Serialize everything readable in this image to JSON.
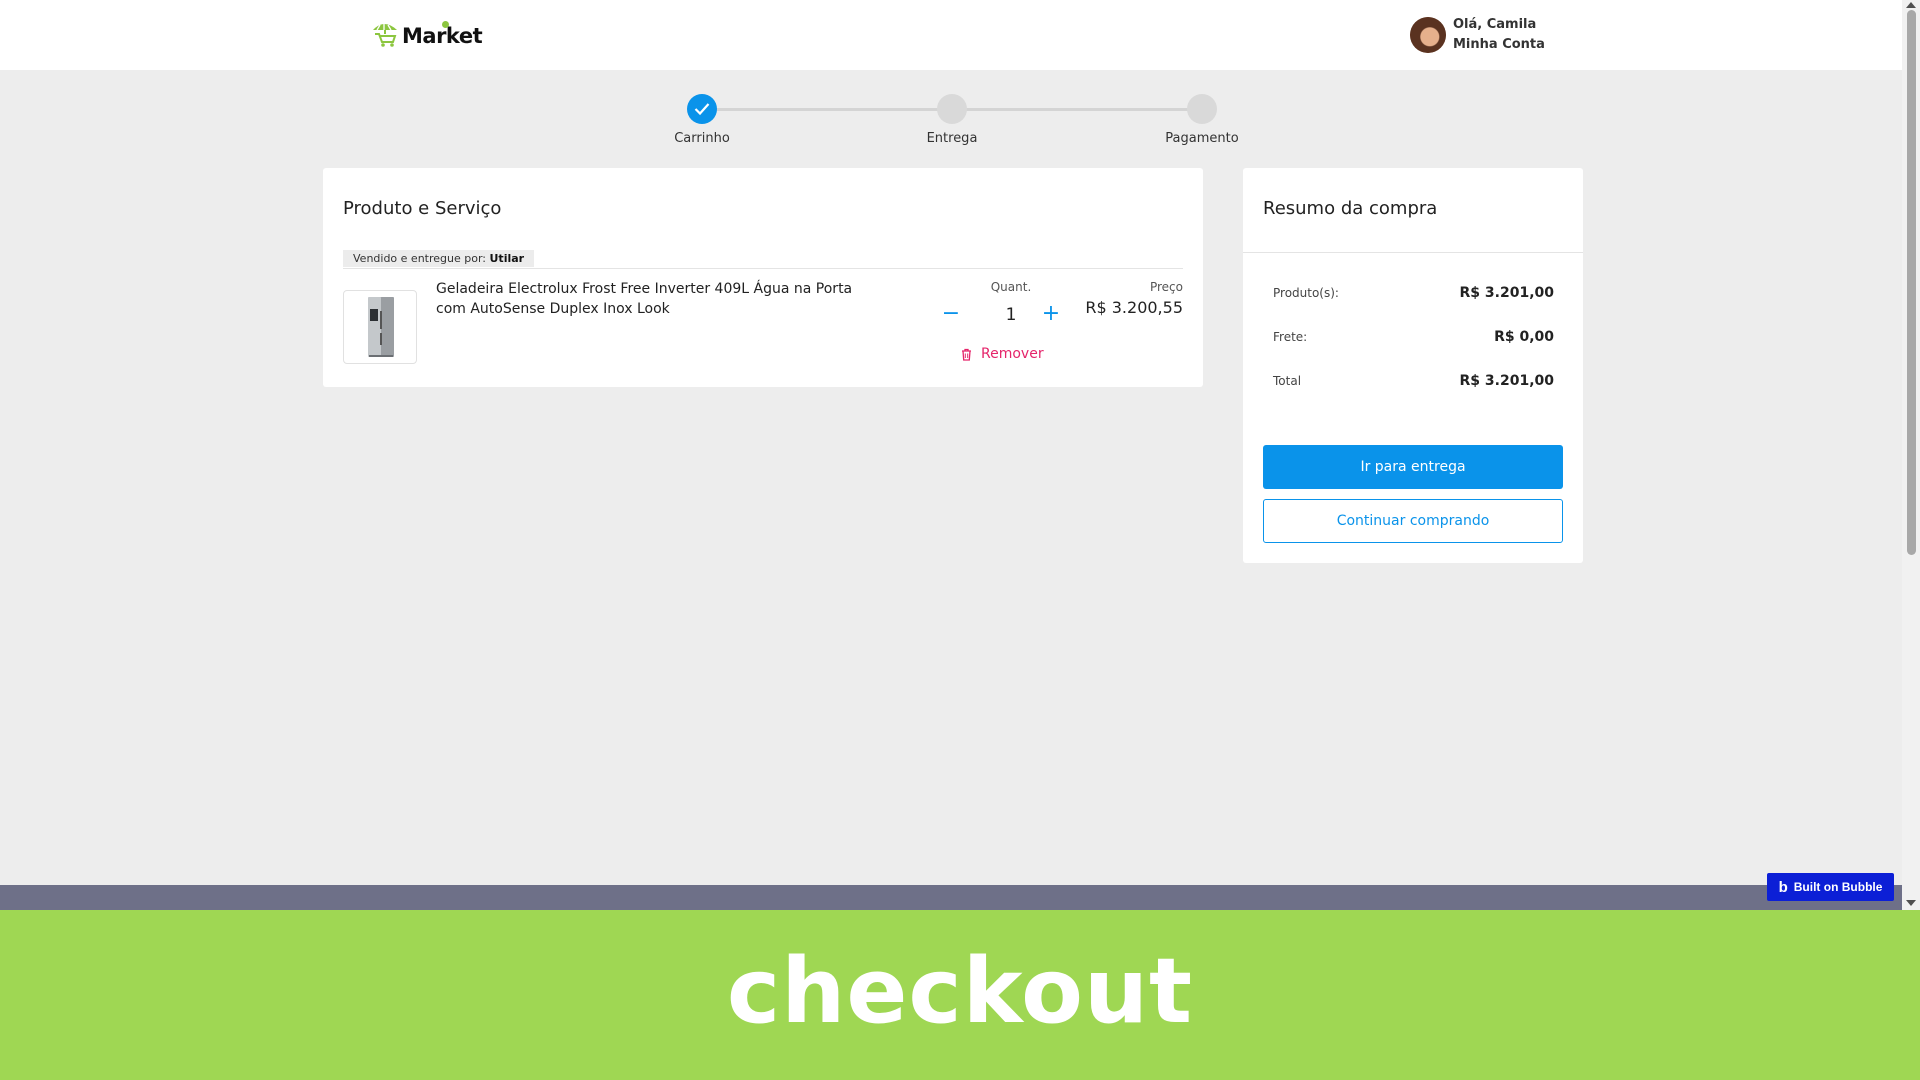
{
  "header": {
    "logo_text": "Market",
    "greeting": "Olá, Camila",
    "account_link": "Minha Conta"
  },
  "stepper": {
    "steps": [
      {
        "label": "Carrinho",
        "status": "done"
      },
      {
        "label": "Entrega",
        "status": "pending"
      },
      {
        "label": "Pagamento",
        "status": "pending"
      }
    ]
  },
  "cart": {
    "title": "Produto e Serviço",
    "seller_prefix": "Vendido e entregue por:",
    "seller_name": "Utilar",
    "item": {
      "name": "Geladeira Electrolux Frost Free Inverter 409L Água na Porta com AutoSense Duplex Inox Look",
      "qty_label": "Quant.",
      "quantity": "1",
      "minus_symbol": "−",
      "plus_symbol": "+",
      "remove_label": "Remover",
      "price_label": "Preço",
      "price": "R$ 3.200,55"
    }
  },
  "summary": {
    "title": "Resumo da compra",
    "rows": [
      {
        "label": "Produto(s):",
        "value": "R$ 3.201,00"
      },
      {
        "label": "Frete:",
        "value": "R$ 0,00"
      },
      {
        "label": "Total",
        "value": "R$ 3.201,00"
      }
    ],
    "primary_button": "Ir para entrega",
    "secondary_button": "Continuar comprando"
  },
  "badge": {
    "icon_letter": "b",
    "label": "Built on Bubble"
  },
  "caption": {
    "text": "checkout"
  },
  "colors": {
    "accent": "#0a93ea",
    "danger": "#e5246a",
    "banner": "#9fd753",
    "logo_green": "#8cc63f",
    "bubble_blue": "#0c1fd6"
  }
}
